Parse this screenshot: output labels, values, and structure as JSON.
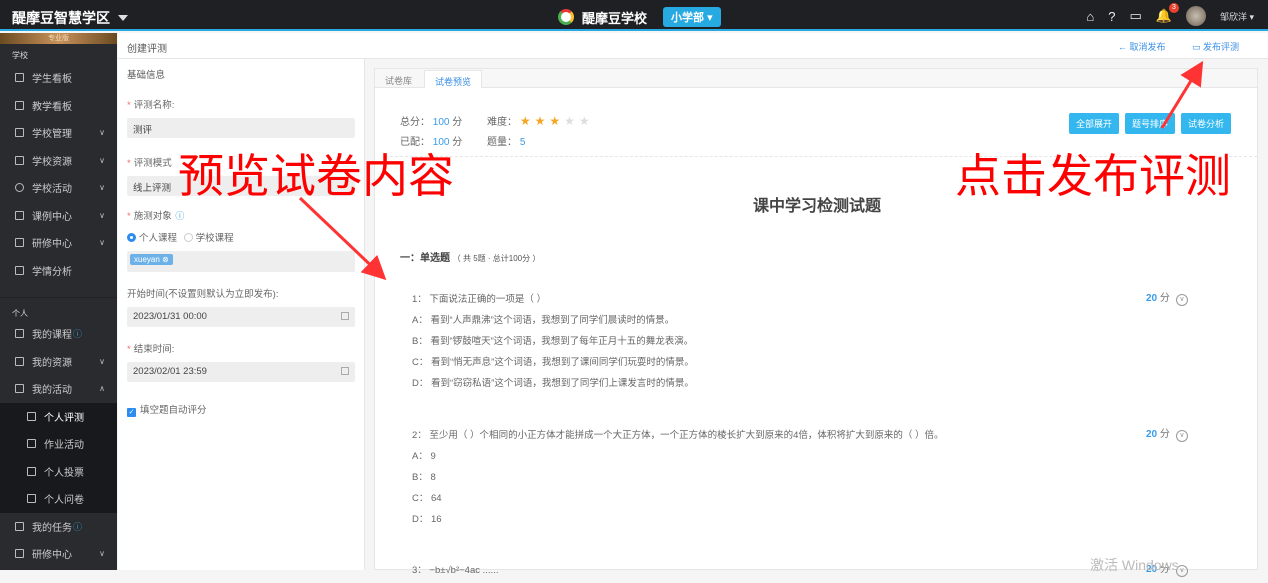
{
  "header": {
    "brand": "醍摩豆智慧学区",
    "school": "醍摩豆学校",
    "dept": "小学部",
    "notif_count": "3",
    "user": "邹欣洋"
  },
  "sidebar": {
    "edition": "专业版",
    "school_label": "学校",
    "school_items": [
      "学生看板",
      "教学看板",
      "学校管理",
      "学校资源",
      "学校活动",
      "课例中心",
      "研修中心",
      "学情分析"
    ],
    "personal_label": "个人",
    "personal_items": [
      "我的课程",
      "我的资源",
      "我的活动"
    ],
    "activity_sub": [
      "个人评测",
      "作业活动",
      "个人投票",
      "个人问卷"
    ],
    "more_items": [
      "我的任务",
      "研修中心"
    ]
  },
  "page": {
    "title": "创建评测",
    "cancel": "取消发布",
    "publish": "发布评测"
  },
  "form": {
    "section": "基础信息",
    "name_label": "评测名称:",
    "name_value": "测评",
    "mode_label": "评测模式",
    "mode_value": "线上评测",
    "target_label": "施测对象",
    "target_opt1": "个人课程",
    "target_opt2": "学校课程",
    "tag": "xueyan",
    "start_label": "开始时间(不设置则默认为立即发布):",
    "start_value": "2023/01/31 00:00",
    "end_label": "结束时间:",
    "end_value": "2023/02/01 23:59",
    "auto_label": "填空题自动评分"
  },
  "preview": {
    "tabs": [
      "试卷库",
      "试卷预览"
    ],
    "total_label": "总分：",
    "total": "100",
    "assigned_label": "已配：",
    "assigned": "100",
    "unit": "分",
    "difficulty_label": "难度：",
    "difficulty": 3,
    "difficulty_max": 5,
    "count_label": "题量：",
    "count": "5",
    "buttons": [
      "全部展开",
      "题号排序",
      "试卷分析"
    ],
    "paper_title": "课中学习检测试题",
    "section": "一：单选题",
    "section_note": "（ 共 5题 · 总计100分 ）",
    "questions": [
      {
        "stem": "1：  下面说法正确的一项是（   ）",
        "score": "20",
        "options": [
          "A：  看到“人声鼎沸”这个词语，我想到了同学们晨读时的情景。",
          "B：  看到“锣鼓喧天”这个词语，我想到了每年正月十五的舞龙表演。",
          "C：  看到“悄无声息”这个词语，我想到了课间同学们玩耍时的情景。",
          "D：  看到“窃窃私语”这个词语，我想到了同学们上课发言时的情景。"
        ]
      },
      {
        "stem": "2：  至少用（   ）个相同的小正方体才能拼成一个大正方体，一个正方体的棱长扩大到原来的4倍，体积将扩大到原来的（   ）倍。",
        "score": "20",
        "options": [
          "A：  9",
          "B：  8",
          "C：  64",
          "D：  16"
        ]
      },
      {
        "stem": "3：     −b±√b²−4ac ......",
        "score": "20",
        "options": []
      }
    ]
  },
  "annotations": {
    "left": "预览试卷内容",
    "right": "点击发布评测"
  },
  "watermark": "激活 Windows"
}
